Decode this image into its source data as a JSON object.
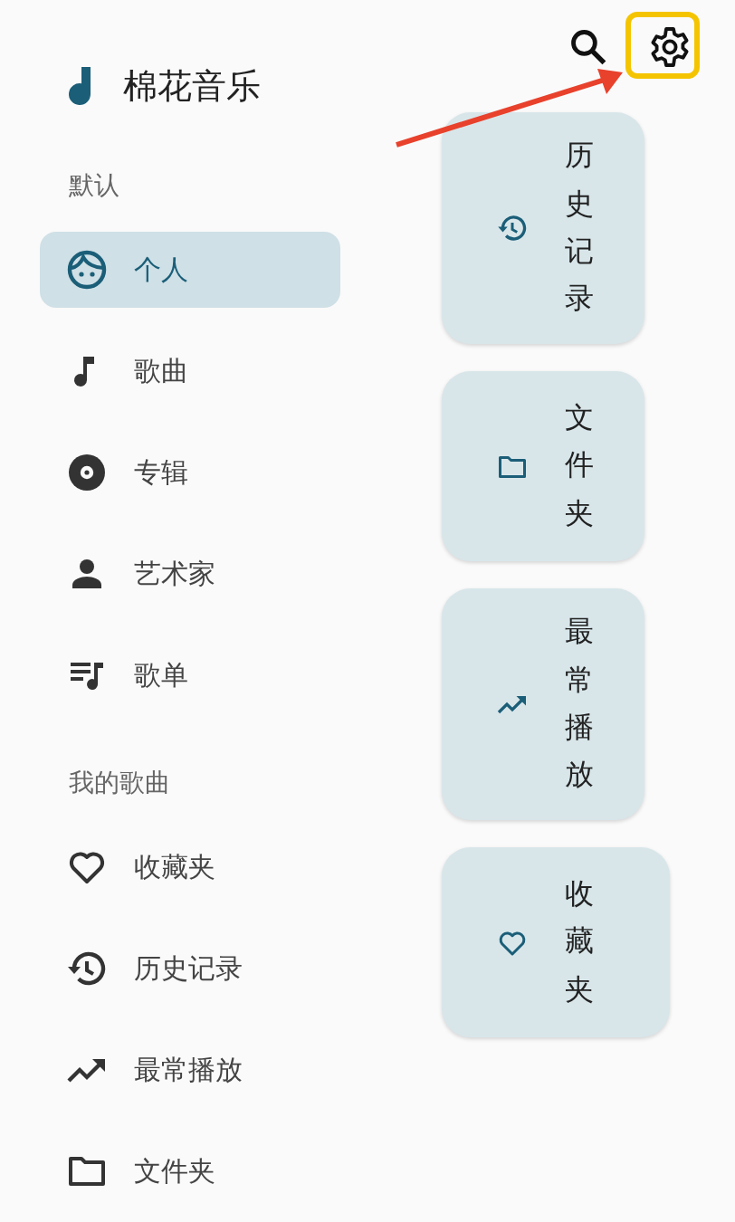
{
  "app": {
    "title": "棉花音乐"
  },
  "toolbar": {
    "settings_highlighted": true
  },
  "sections": [
    {
      "title": "默认",
      "items": [
        {
          "label": "个人",
          "selected": true
        },
        {
          "label": "歌曲",
          "selected": false
        },
        {
          "label": "专辑",
          "selected": false
        },
        {
          "label": "艺术家",
          "selected": false
        },
        {
          "label": "歌单",
          "selected": false
        }
      ]
    },
    {
      "title": "我的歌曲",
      "items": [
        {
          "label": "收藏夹",
          "selected": false
        },
        {
          "label": "历史记录",
          "selected": false
        },
        {
          "label": "最常播放",
          "selected": false
        },
        {
          "label": "文件夹",
          "selected": false
        }
      ]
    }
  ],
  "shortcuts": [
    {
      "label": "历史记录"
    },
    {
      "label": "文件夹"
    },
    {
      "label": "最常播放"
    },
    {
      "label": "收藏夹"
    }
  ]
}
